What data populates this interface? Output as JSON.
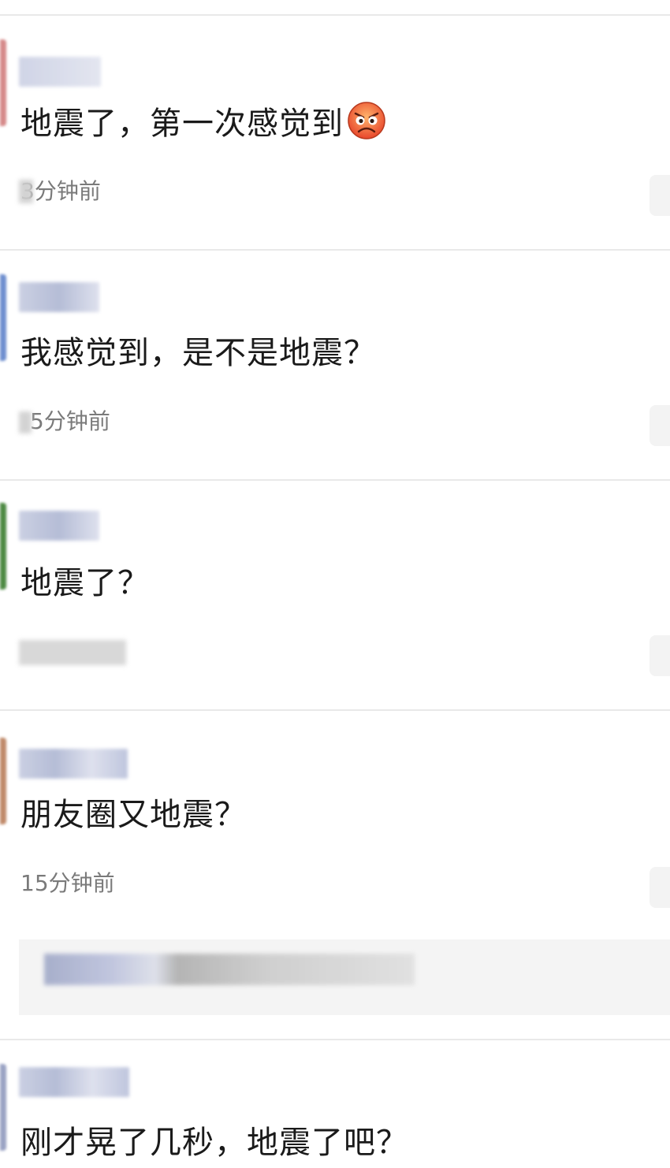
{
  "comments": [
    {
      "text": "地震了，第一次感觉到",
      "time": "3分钟前",
      "emoji": "angry-face-emoji",
      "avatar_color": "#d68a8a"
    },
    {
      "text": "我感觉到，是不是地震？",
      "time": "5分钟前",
      "avatar_color": "#6f8fcf"
    },
    {
      "text": "地震了？",
      "time": "",
      "avatar_color": "#4d8a43"
    },
    {
      "text": "朋友圈又地震？",
      "time": "15分钟前",
      "avatar_color": "#c08a6a"
    },
    {
      "text": "刚才晃了几秒，地震了吧？",
      "time": "",
      "avatar_color": "#9aa3c4"
    }
  ],
  "colors": {
    "text": "#1a1a1a",
    "timestamp": "#7a7a7a",
    "divider": "#e9e9e9",
    "reply_background": "#f4f4f4",
    "blurred_username": "#b9bfd6"
  }
}
